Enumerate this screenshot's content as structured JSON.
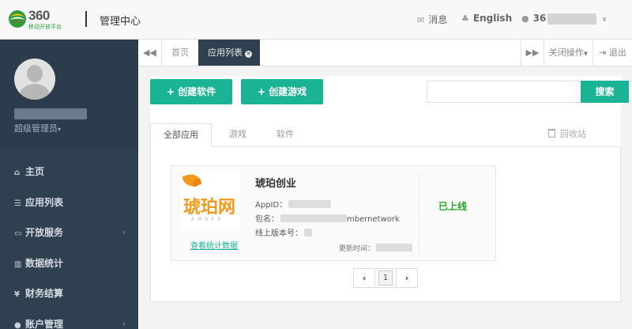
{
  "header": {
    "logo_text": "360",
    "logo_subtext": "移动开放平台",
    "title": "管理中心",
    "messages_label": "消息",
    "language_label": "English",
    "user_label": "36",
    "messages_icon": "envelope-icon",
    "language_icon": "sitemap-icon",
    "user_icon": "user-icon"
  },
  "sidebar": {
    "role_label": "超级管理员",
    "items": [
      {
        "icon": "home-icon",
        "glyph": "⌂",
        "label": "主页",
        "has_arrow": false
      },
      {
        "icon": "list-icon",
        "glyph": "☰",
        "label": "应用列表",
        "has_arrow": false
      },
      {
        "icon": "desktop-icon",
        "glyph": "▭",
        "label": "开放服务",
        "has_arrow": true
      },
      {
        "icon": "bar-chart-icon",
        "glyph": "▥",
        "label": "数据统计",
        "has_arrow": false
      },
      {
        "icon": "yen-icon",
        "glyph": "¥",
        "label": "财务结算",
        "has_arrow": false
      },
      {
        "icon": "user-icon",
        "glyph": "●",
        "label": "账户管理",
        "has_arrow": true
      }
    ]
  },
  "tabs": {
    "home_label": "首页",
    "active_label": "应用列表",
    "close_ops_label": "关闭操作",
    "logout_label": "退出"
  },
  "toolbar": {
    "create_software_label": "创建软件",
    "create_game_label": "创建游戏",
    "search_placeholder": "",
    "search_button_label": "搜索"
  },
  "subtabs": {
    "all_label": "全部应用",
    "games_label": "游戏",
    "software_label": "软件",
    "recycle_label": "回收站"
  },
  "app": {
    "name": "琥珀创业",
    "logo_text": "琥珀网",
    "logo_tagline": "AMBER",
    "appid_label": "AppID：",
    "package_label": "包名：",
    "package_suffix": "mbernetwork",
    "version_label": "线上版本号：",
    "updated_label": "更新时间：",
    "status": "已上线",
    "stats_link": "查看统计数据"
  },
  "pagination": {
    "current_page": "1"
  },
  "colors": {
    "accent": "#1ab394",
    "sidebar_bg": "#2f4050",
    "online_status": "#2aa52a",
    "logo_orange": "#f39a1e"
  }
}
